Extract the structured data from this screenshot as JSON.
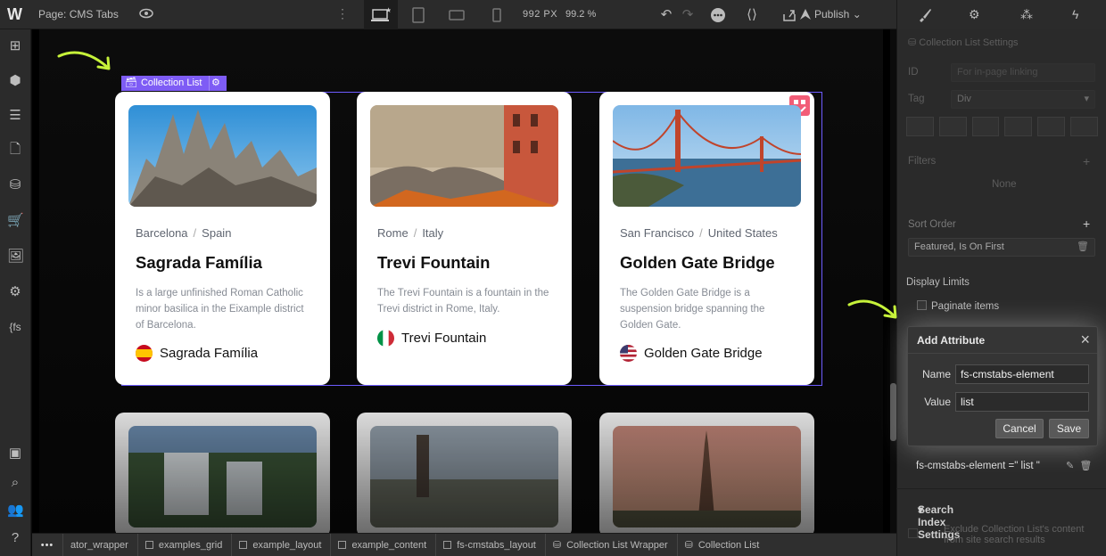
{
  "topbar": {
    "logo": "W",
    "page": "Page: CMS Tabs",
    "size_px": "992 PX",
    "zoom": "99.2 %",
    "publish": "Publish"
  },
  "canvas": {
    "collection_label": "Collection List",
    "cards": [
      {
        "city": "Barcelona",
        "country": "Spain",
        "title": "Sagrada Família",
        "desc": "Is a large unfinished Roman Catholic minor basilica in the Eixample district of Barcelona.",
        "flag_label": "Sagrada Família"
      },
      {
        "city": "Rome",
        "country": "Italy",
        "title": "Trevi Fountain",
        "desc": "The Trevi Fountain is a fountain in the Trevi district in Rome, Italy.",
        "flag_label": "Trevi Fountain"
      },
      {
        "city": "San Francisco",
        "country": "United States",
        "title": "Golden Gate Bridge",
        "desc": "The Golden Gate Bridge is a suspension bridge spanning the Golden Gate.",
        "flag_label": "Golden Gate Bridge"
      }
    ]
  },
  "breadcrumbs": [
    "ator_wrapper",
    "examples_grid",
    "example_layout",
    "example_content",
    "fs-cmstabs_layout",
    "Collection List Wrapper",
    "Collection List"
  ],
  "panel": {
    "header": "Collection List Settings",
    "id_label": "ID",
    "id_placeholder": "For in-page linking",
    "tag_label": "Tag",
    "tag_value": "Div",
    "filters_label": "Filters",
    "filters_value": "None",
    "sort_label": "Sort Order",
    "sort_value": "Featured, Is On First",
    "display_limits": "Display Limits",
    "paginate": "Paginate items",
    "attribute_line": "fs-cmstabs-element =\" list \"",
    "search_section": "Search Index Settings",
    "search_option": "Exclude Collection List's content from site search results"
  },
  "modal": {
    "title": "Add Attribute",
    "name_label": "Name",
    "name_value": "fs-cmstabs-element",
    "value_label": "Value",
    "value_value": "list",
    "cancel": "Cancel",
    "save": "Save"
  },
  "colors": {
    "accent_purple": "#7e5cf5",
    "arrow_green": "#c6f23a",
    "badge_pink": "#f25d77"
  }
}
